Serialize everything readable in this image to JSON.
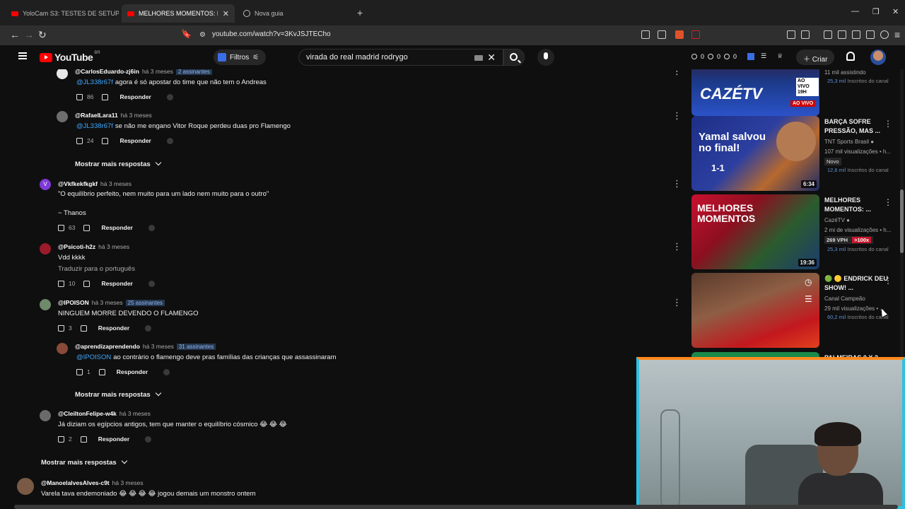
{
  "browser": {
    "tabs": [
      {
        "label": "YoloCam S3: TESTES DE SETUP (OBS",
        "active": false
      },
      {
        "label": "MELHORES MOMENTOS: PALME",
        "active": true
      },
      {
        "label": "Nova guia",
        "active": false
      }
    ],
    "url": "youtube.com/watch?v=3KvJSJTECho"
  },
  "header": {
    "logo": "YouTube",
    "country": "BR",
    "filters_label": "Filtros",
    "search_value": "virada do real madrid rodrygo",
    "counters": [
      "0",
      "0",
      "0"
    ],
    "create_label": "Criar"
  },
  "comments": [
    {
      "user": "@CarlosEduardo-zj6in",
      "time": "há 3 meses",
      "badge": "2 assinantes",
      "mention": "@JL338r67f",
      "text": "agora é só apostar do time que não tem o Andreas",
      "likes": "86",
      "reply": "Responder"
    },
    {
      "user": "@RafaelLara11",
      "time": "há 3 meses",
      "badge": "",
      "mention": "@JL338r67f",
      "text": "se não me engano Vitor Roque perdeu duas pro Flamengo",
      "likes": "24",
      "reply": "Responder"
    },
    {
      "user": "@Vkfkekfkgkf",
      "time": "há 3 meses",
      "badge": "",
      "mention": "",
      "text": "\"O equilíbrio perfeito, nem muito para um lado nem muito para o outro\"",
      "text2": "~ Thanos",
      "likes": "63",
      "reply": "Responder"
    },
    {
      "user": "@Psicoti-h2z",
      "time": "há 3 meses",
      "badge": "",
      "mention": "",
      "text": "Vdd kkkk",
      "translate": "Traduzir para o português",
      "likes": "10",
      "reply": "Responder"
    },
    {
      "user": "@IPOISON",
      "time": "há 3 meses",
      "badge": "25 assinantes",
      "mention": "",
      "text": "NINGUEM MORRE DEVENDO O FLAMENGO",
      "likes": "3",
      "reply": "Responder"
    },
    {
      "user": "@aprendizaprendendo",
      "time": "há 3 meses",
      "badge": "31 assinantes",
      "mention": "@IPOISON",
      "text": "ao contrário o flamengo deve pras famílias das crianças que assassinaram",
      "likes": "1",
      "reply": "Responder"
    },
    {
      "user": "@CleiltonFelipe-w4k",
      "time": "há 3 meses",
      "badge": "",
      "mention": "",
      "text": "Já diziam os egípcios antigos, tem que manter o equilíbrio cósmico 😂 😂 😂",
      "likes": "2",
      "reply": "Responder"
    },
    {
      "user": "@ManoelalvesAlves-c9t",
      "time": "há 3 meses",
      "badge": "",
      "mention": "",
      "text": "Varela tava endemoniado 😂 😂 😂 😂 jogou demais um monstro ontem",
      "likes": "",
      "reply": ""
    }
  ],
  "show_more_replies": "Mostrar mais respostas",
  "sidebar": {
    "top_partial": {
      "views": "11 mil assistindo",
      "subs_value": "25,3 mil",
      "subs_label": "Inscritos do canal",
      "live": "AO VIVO",
      "thumb_text": "CAZÉTV",
      "live_badge": "AO VIVO 19H"
    },
    "videos": [
      {
        "title": "BARÇA SOFRE PRESSÃO, MAS ...",
        "channel": "TNT Sports Brasil",
        "views": "107 mil visualizações • h...",
        "tag": "Novo",
        "subs_value": "12,6 mil",
        "subs_label": "Inscritos do canal",
        "duration": "6:34",
        "thumb_title": "Yamal salvou no final!",
        "score": "1-1"
      },
      {
        "title": "MELHORES MOMENTOS: ...",
        "channel": "CazéTV",
        "views": "2 mi de visualizações • h...",
        "tag": "269 VPH",
        "tag2": ">100x",
        "subs_value": "25,3 mil",
        "subs_label": "Inscritos do canal",
        "duration": "19:36",
        "thumb_title": "MELHORES MOMENTOS"
      },
      {
        "title": "🟢 🟡 ENDRICK DEU SHOW! ...",
        "channel": "Canal Campeão",
        "views": "29 mil visualizações • ...",
        "subs_value": "60,2 mil",
        "subs_label": "Inscritos do canal"
      },
      {
        "title": "PALMEIRAS 0 X 2 ..."
      }
    ]
  },
  "colors": {
    "accent": "#3ea6ff",
    "youtube_red": "#ff0000",
    "webcam_border_top": "#ff8a1e",
    "webcam_border": "#2fc0e0"
  }
}
